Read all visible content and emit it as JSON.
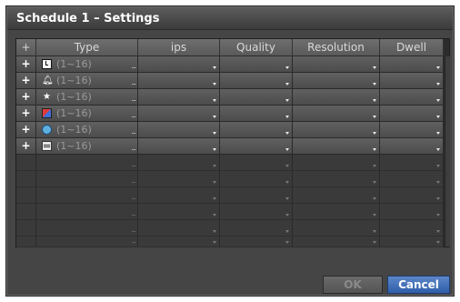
{
  "dialog": {
    "title": "Schedule 1 – Settings"
  },
  "table": {
    "headers": [
      "+",
      "Type",
      "ips",
      "Quality",
      "Resolution",
      "Dwell"
    ],
    "rows": [
      {
        "icon": "time-clock-icon",
        "range": "(1~16)"
      },
      {
        "icon": "alarm-bell-icon",
        "range": "(1~16)"
      },
      {
        "icon": "motion-runner-icon",
        "range": "(1~16)"
      },
      {
        "icon": "video-loss-icon",
        "range": "(1~16)"
      },
      {
        "icon": "tamper-eye-icon",
        "range": "(1~16)"
      },
      {
        "icon": "text-input-icon",
        "range": "(1~16)"
      }
    ],
    "add_symbol": "+",
    "ellipsis": "...",
    "empty_rows": 6
  },
  "buttons": {
    "ok": "OK",
    "cancel": "Cancel"
  }
}
